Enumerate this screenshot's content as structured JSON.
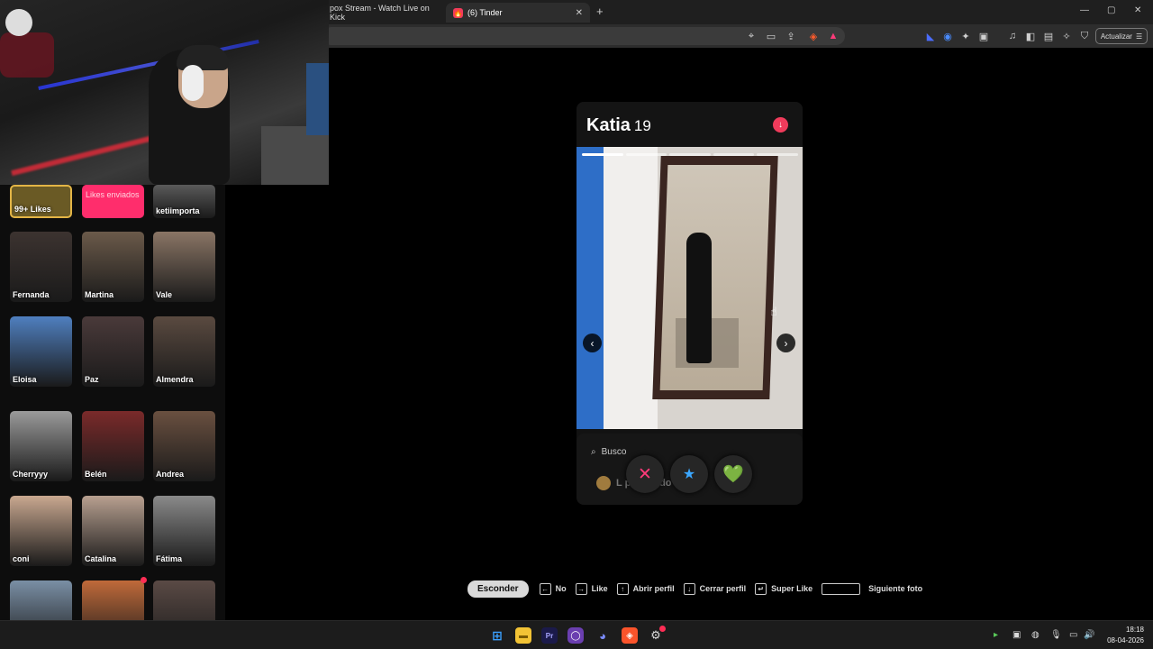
{
  "browser": {
    "tabs": [
      {
        "label": "pox Stream - Watch Live on Kick",
        "active": false
      },
      {
        "label": "(6) Tinder",
        "active": true,
        "close": "✕"
      }
    ],
    "new_tab": "+",
    "window_controls": [
      "—",
      "▢",
      "✕"
    ],
    "update_label": "Actualizar",
    "toolbar_icons": [
      "location-icon",
      "cast-icon",
      "share-icon",
      "brave-shield-icon",
      "brave-rewards-icon",
      "cursor-ext-icon",
      "audio-icon",
      "extensions-icon",
      "sidebar-icon",
      "wallet-icon",
      "music-icon",
      "leo-icon",
      "vpn-icon",
      "playlist-icon"
    ]
  },
  "likes_panel": {
    "likes_card": {
      "label": "99+ Likes"
    },
    "sent_card": {
      "label": "Likes enviados"
    },
    "profiles": [
      {
        "name": "ketiimporta",
        "color": "#5a5a5a"
      },
      {
        "name": "Fernanda",
        "color": "#3c3330"
      },
      {
        "name": "Martina",
        "color": "#6b5a4a"
      },
      {
        "name": "Vale",
        "color": "#8a7565"
      },
      {
        "name": "Eloisa",
        "color": "#4f7fbf"
      },
      {
        "name": "Paz",
        "color": "#4a3a3a"
      },
      {
        "name": "Almendra",
        "color": "#5a4a40"
      },
      {
        "name": "Cherryyy",
        "color": "#9a9a9a"
      },
      {
        "name": "Belén",
        "color": "#7a2a2a"
      },
      {
        "name": "Andrea",
        "color": "#6a5040"
      },
      {
        "name": "coni",
        "color": "#c9a890"
      },
      {
        "name": "Catalina",
        "color": "#b8a090"
      },
      {
        "name": "Fátima",
        "color": "#8a8a8a"
      },
      {
        "name": "",
        "color": "#7a8fa5"
      },
      {
        "name": "",
        "color": "#c06a3a"
      },
      {
        "name": "",
        "color": "#5a4a45"
      }
    ]
  },
  "profile": {
    "name": "Katia",
    "age": "19",
    "photo_count": 5,
    "current_photo": 1,
    "busco_label": "Busco",
    "looking_text": "L        pensando"
  },
  "actions": {
    "nope": "✕",
    "superlike": "★",
    "like": "💚"
  },
  "shortcuts": {
    "hide_button": "Esconder",
    "items": [
      {
        "key": "←",
        "label": "No"
      },
      {
        "key": "→",
        "label": "Like"
      },
      {
        "key": "↑",
        "label": "Abrir perfil"
      },
      {
        "key": "↓",
        "label": "Cerrar perfil"
      },
      {
        "key": "↵",
        "label": "Super Like"
      },
      {
        "key": "",
        "label": "Siguiente foto"
      }
    ]
  },
  "taskbar": {
    "time": "18:18",
    "date": "08-04-2026",
    "apps": [
      "windows-start-icon",
      "file-explorer-icon",
      "premiere-icon",
      "obs-icon",
      "discord-icon",
      "brave-icon",
      "steam-icon"
    ]
  },
  "colors": {
    "tinder_red": "#f03b5b",
    "likes_sent_pink": "#ff2d6c",
    "likes_gold": "#e3b546"
  }
}
